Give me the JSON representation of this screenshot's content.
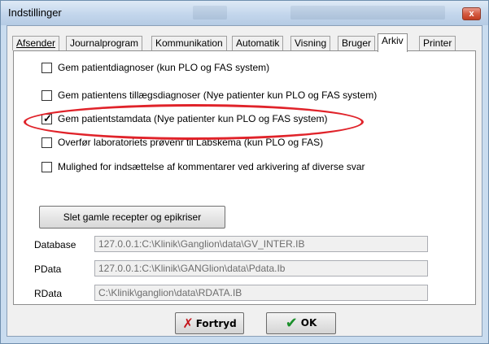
{
  "window": {
    "title": "Indstillinger",
    "close_label": "x"
  },
  "tabs": [
    {
      "label": "Afsender"
    },
    {
      "label": "Journalprogram"
    },
    {
      "label": "Kommunikation"
    },
    {
      "label": "Automatik"
    },
    {
      "label": "Visning"
    },
    {
      "label": "Bruger"
    },
    {
      "label": "Arkiv",
      "active": true
    },
    {
      "label": "Printer"
    }
  ],
  "options": [
    {
      "label": "Gem patientdiagnoser (kun PLO og FAS system)",
      "checked": false
    },
    {
      "label": "Gem patientens tillægsdiagnoser (Nye patienter kun PLO og FAS system)",
      "checked": false
    },
    {
      "label": "Gem patientstamdata (Nye patienter kun PLO og FAS system)",
      "checked": true
    },
    {
      "label": "Overfør laboratoriets prøvenr til Labskema (kun PLO og FAS)",
      "checked": false
    },
    {
      "label": "Mulighed for indsættelse af kommentarer ved arkivering af diverse svar",
      "checked": false
    }
  ],
  "delete_button": "Slet gamle recepter og epikriser",
  "fields": [
    {
      "label": "Database",
      "value": "127.0.0.1:C:\\Klinik\\Ganglion\\data\\GV_INTER.IB"
    },
    {
      "label": "PData",
      "value": "127.0.0.1:C:\\Klinik\\GANGlion\\data\\Pdata.Ib"
    },
    {
      "label": "RData",
      "value": "C:\\Klinik\\ganglion\\data\\RDATA.IB"
    }
  ],
  "footer": {
    "cancel_label": "Fortryd",
    "ok_label": "OK"
  },
  "colors": {
    "highlight_ellipse": "#e0232a",
    "ok_check": "#1a8f2a",
    "cancel_x": "#c4161c"
  }
}
